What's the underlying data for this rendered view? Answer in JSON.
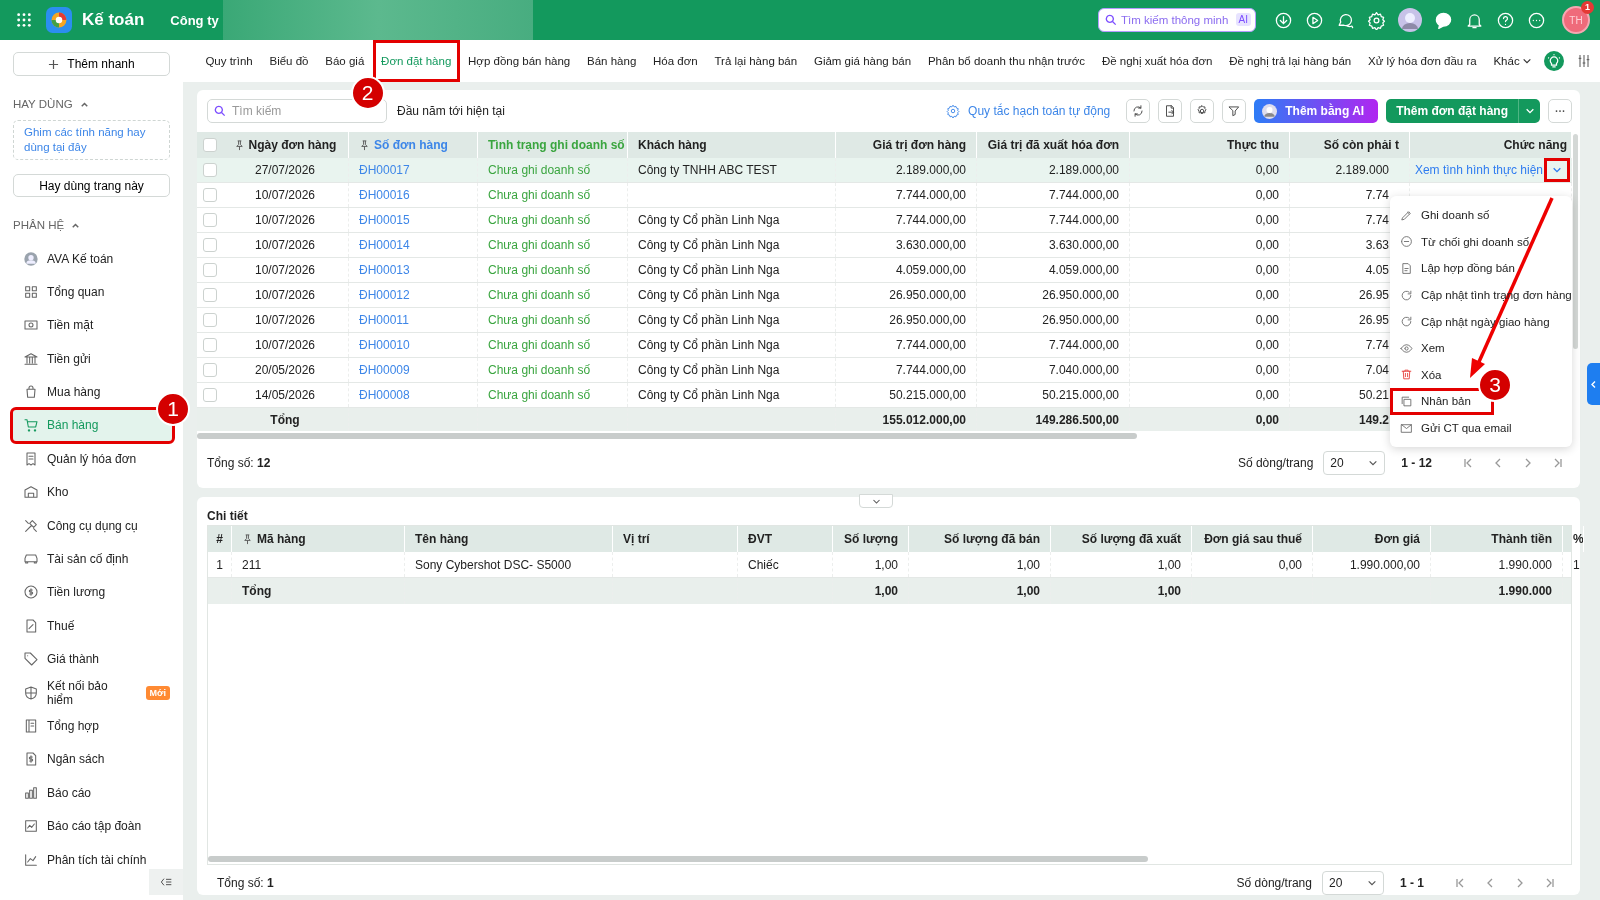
{
  "topbar": {
    "app_name": "Kế toán",
    "company": "Công ty",
    "search": {
      "placeholder": "Tìm kiếm thông minh",
      "badge": "AI"
    },
    "user": {
      "initials": "TH",
      "badge": "1"
    }
  },
  "tabs": [
    {
      "label": "Quy trình",
      "selected": false
    },
    {
      "label": "Biểu đồ",
      "selected": false
    },
    {
      "label": "Báo giá",
      "selected": false
    },
    {
      "label": "Đơn đặt hàng",
      "selected": true,
      "callout": "2"
    },
    {
      "label": "Hợp đồng bán hàng",
      "selected": false
    },
    {
      "label": "Bán hàng",
      "selected": false
    },
    {
      "label": "Hóa đơn",
      "selected": false
    },
    {
      "label": "Trả lại hàng bán",
      "selected": false
    },
    {
      "label": "Giảm giá hàng bán",
      "selected": false
    },
    {
      "label": "Phân bổ doanh thu nhận trước",
      "selected": false
    },
    {
      "label": "Đề nghị xuất hóa đơn",
      "selected": false
    },
    {
      "label": "Đề nghị trả lại hàng bán",
      "selected": false
    },
    {
      "label": "Xử lý hóa đơn đầu ra",
      "selected": false
    },
    {
      "label": "Khác",
      "selected": false
    }
  ],
  "sidebar": {
    "quick_add": "Thêm nhanh",
    "favorites_title": "HAY DÙNG",
    "favorites_hint": "Ghim các tính năng hay dùng tại đây",
    "favorite_button": "Hay dùng trang này",
    "modules_title": "PHÂN HỆ",
    "items": [
      {
        "label": "AVA Kế toán",
        "kind": "avatar",
        "selected": false
      },
      {
        "label": "Tổng quan",
        "kind": "grid",
        "selected": false
      },
      {
        "label": "Tiền mặt",
        "kind": "cash",
        "selected": false
      },
      {
        "label": "Tiền gửi",
        "kind": "bank",
        "selected": false
      },
      {
        "label": "Mua hàng",
        "kind": "bag",
        "selected": false
      },
      {
        "label": "Bán hàng",
        "kind": "cart",
        "selected": true,
        "callout": "1"
      },
      {
        "label": "Quản lý hóa đơn",
        "kind": "receipt",
        "selected": false
      },
      {
        "label": "Kho",
        "kind": "warehouse",
        "selected": false
      },
      {
        "label": "Công cụ dụng cụ",
        "kind": "tools",
        "selected": false
      },
      {
        "label": "Tài sản cố định",
        "kind": "car",
        "selected": false
      },
      {
        "label": "Tiền lương",
        "kind": "dollar",
        "selected": false
      },
      {
        "label": "Thuế",
        "kind": "tax",
        "selected": false
      },
      {
        "label": "Giá thành",
        "kind": "tag",
        "selected": false
      },
      {
        "label": "Kết nối bảo hiểm",
        "kind": "shield",
        "selected": false,
        "badge": "Mới"
      },
      {
        "label": "Tổng hợp",
        "kind": "book",
        "selected": false
      },
      {
        "label": "Ngân sách",
        "kind": "budget",
        "selected": false
      },
      {
        "label": "Báo cáo",
        "kind": "chart",
        "selected": false
      },
      {
        "label": "Báo cáo tập đoàn",
        "kind": "trend",
        "selected": false
      },
      {
        "label": "Phân tích tài chính",
        "kind": "analysis",
        "selected": false
      }
    ]
  },
  "toolbar": {
    "search_placeholder": "Tìm kiếm",
    "period": "Đầu năm tới hiện tại",
    "rules_link": "Quy tắc hạch toán tự động",
    "ai_button": "Thêm bằng AI",
    "add_button": "Thêm đơn đặt hàng"
  },
  "orders": {
    "all_checked": false,
    "columns": [
      {
        "label": "Ngày đơn hàng",
        "kind": "date",
        "pinned": true
      },
      {
        "label": "Số đơn hàng",
        "kind": "link",
        "pinned": true
      },
      {
        "label": "Tình trạng ghi doanh số",
        "kind": "status",
        "pinned": false
      },
      {
        "label": "Khách hàng",
        "kind": "text",
        "pinned": false
      },
      {
        "label": "Giá trị đơn hàng",
        "kind": "money",
        "pinned": false
      },
      {
        "label": "Giá trị đã xuất hóa đơn",
        "kind": "money",
        "pinned": false
      },
      {
        "label": "Thực thu",
        "kind": "money",
        "pinned": false
      },
      {
        "label": "Số còn phải t",
        "kind": "money",
        "pinned": false
      },
      {
        "label": "Chức năng",
        "kind": "action",
        "pinned": false
      }
    ],
    "rows": [
      {
        "selected": true,
        "checked": false,
        "cells": [
          "27/07/2026",
          "ĐH00017",
          "Chưa ghi doanh số",
          "Công ty TNHH ABC TEST",
          "2.189.000,00",
          "2.189.000,00",
          "0,00",
          "2.189.000"
        ],
        "action": "Xem tình hình thực hiện",
        "action_callout": true
      },
      {
        "selected": false,
        "checked": false,
        "cells": [
          "10/07/2026",
          "ĐH00016",
          "Chưa ghi doanh số",
          "",
          "7.744.000,00",
          "7.744.000,00",
          "0,00",
          "7.74"
        ]
      },
      {
        "selected": false,
        "checked": false,
        "cells": [
          "10/07/2026",
          "ĐH00015",
          "Chưa ghi doanh số",
          "Công ty Cổ phần Linh Nga",
          "7.744.000,00",
          "7.744.000,00",
          "0,00",
          "7.74"
        ]
      },
      {
        "selected": false,
        "checked": false,
        "cells": [
          "10/07/2026",
          "ĐH00014",
          "Chưa ghi doanh số",
          "Công ty Cổ phần Linh Nga",
          "3.630.000,00",
          "3.630.000,00",
          "0,00",
          "3.63"
        ]
      },
      {
        "selected": false,
        "checked": false,
        "cells": [
          "10/07/2026",
          "ĐH00013",
          "Chưa ghi doanh số",
          "Công ty Cổ phần Linh Nga",
          "4.059.000,00",
          "4.059.000,00",
          "0,00",
          "4.05"
        ]
      },
      {
        "selected": false,
        "checked": false,
        "cells": [
          "10/07/2026",
          "ĐH00012",
          "Chưa ghi doanh số",
          "Công ty Cổ phần Linh Nga",
          "26.950.000,00",
          "26.950.000,00",
          "0,00",
          "26.95"
        ]
      },
      {
        "selected": false,
        "checked": false,
        "cells": [
          "10/07/2026",
          "ĐH00011",
          "Chưa ghi doanh số",
          "Công ty Cổ phần Linh Nga",
          "26.950.000,00",
          "26.950.000,00",
          "0,00",
          "26.95"
        ]
      },
      {
        "selected": false,
        "checked": false,
        "cells": [
          "10/07/2026",
          "ĐH00010",
          "Chưa ghi doanh số",
          "Công ty Cổ phần Linh Nga",
          "7.744.000,00",
          "7.744.000,00",
          "0,00",
          "7.74"
        ]
      },
      {
        "selected": false,
        "checked": false,
        "cells": [
          "20/05/2026",
          "ĐH00009",
          "Chưa ghi doanh số",
          "Công ty Cổ phần Linh Nga",
          "7.744.000,00",
          "7.040.000,00",
          "0,00",
          "7.04"
        ]
      },
      {
        "selected": false,
        "checked": false,
        "cells": [
          "14/05/2026",
          "ĐH00008",
          "Chưa ghi doanh số",
          "Công ty Cổ phần Linh Nga",
          "50.215.000,00",
          "50.215.000,00",
          "0,00",
          "50.21"
        ]
      }
    ],
    "totals": {
      "label": "Tổng",
      "order_value": "155.012.000,00",
      "invoiced": "149.286.500,00",
      "collected": "0,00",
      "remaining": "149.2"
    },
    "footer": {
      "count": "Tổng số: **12**",
      "page_size_label": "Số dòng/trang",
      "page_size": "20",
      "range": "1 - 12"
    }
  },
  "menu": [
    {
      "label": "Ghi doanh số",
      "kind": "pencil"
    },
    {
      "label": "Từ chối ghi doanh số",
      "kind": "block"
    },
    {
      "label": "Lập hợp đồng bán",
      "kind": "contract"
    },
    {
      "label": "Cập nhật tình trạng đơn hàng",
      "kind": "refresh"
    },
    {
      "label": "Cập nhật ngày giao hàng",
      "kind": "refresh"
    },
    {
      "label": "Xem",
      "kind": "eye"
    },
    {
      "label": "Xóa",
      "kind": "trash"
    },
    {
      "label": "Nhân bản",
      "kind": "copy",
      "callout": "3"
    },
    {
      "label": "Gửi CT qua email",
      "kind": "mail"
    }
  ],
  "detail": {
    "title": "Chi tiết",
    "expanded": true,
    "columns": [
      {
        "label": "#",
        "kind": "index",
        "pinned": false
      },
      {
        "label": "Mã hàng",
        "kind": "text",
        "pinned": true
      },
      {
        "label": "Tên hàng",
        "kind": "text",
        "pinned": false
      },
      {
        "label": "Vị trí",
        "kind": "text",
        "pinned": false
      },
      {
        "label": "ĐVT",
        "kind": "text",
        "pinned": false
      },
      {
        "label": "Số lượng",
        "kind": "money",
        "pinned": false
      },
      {
        "label": "Số lượng đã bán",
        "kind": "money",
        "pinned": false
      },
      {
        "label": "Số lượng đã xuất",
        "kind": "money",
        "pinned": false
      },
      {
        "label": "Đơn giá sau thuế",
        "kind": "money",
        "pinned": false
      },
      {
        "label": "Đơn giá",
        "kind": "money",
        "pinned": false
      },
      {
        "label": "Thành tiền",
        "kind": "money",
        "pinned": false
      },
      {
        "label": "%",
        "kind": "text",
        "pinned": false
      }
    ],
    "rows": [
      [
        "1",
        "211",
        "Sony Cybershot DSC- S5000",
        "",
        "Chiếc",
        "1,00",
        "1,00",
        "1,00",
        "0,00",
        "1.990.000,00",
        "1.990.000",
        "1"
      ]
    ],
    "totals": {
      "label": "Tổng",
      "quantity": "1,00",
      "sold": "1,00",
      "issued": "1,00",
      "amount": "1.990.000"
    },
    "footer": {
      "count": "Tổng số: **1**",
      "page_size_label": "Số dòng/trang",
      "page_size": "20",
      "range": "1 - 1"
    }
  }
}
